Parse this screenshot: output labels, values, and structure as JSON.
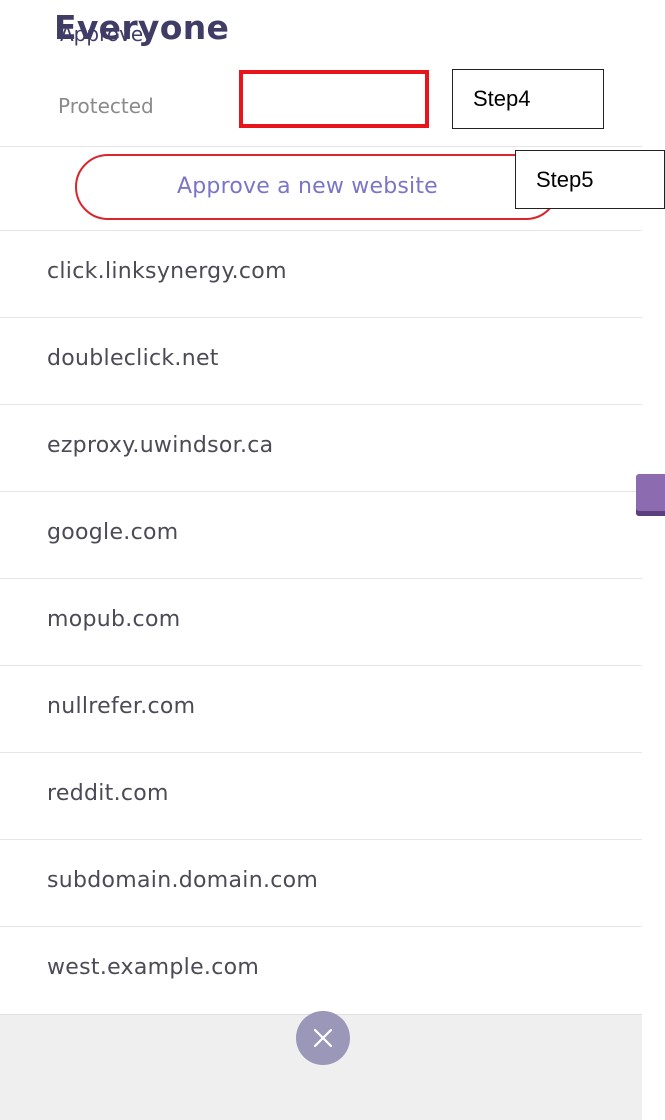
{
  "header": {
    "title": "Everyone"
  },
  "tabs": [
    {
      "label": "Protected",
      "active": false
    },
    {
      "label": "Approve",
      "active": true
    }
  ],
  "annotations": {
    "step4": "Step4",
    "step5": "Step5",
    "highlight_color": "#e8141c"
  },
  "approve_button": {
    "label": "Approve a new website"
  },
  "websites": [
    {
      "domain": "click.linksynergy.com"
    },
    {
      "domain": "doubleclick.net"
    },
    {
      "domain": "ezproxy.uwindsor.ca"
    },
    {
      "domain": "google.com"
    },
    {
      "domain": "mopub.com"
    },
    {
      "domain": "nullrefer.com"
    },
    {
      "domain": "reddit.com"
    },
    {
      "domain": "subdomain.domain.com"
    },
    {
      "domain": "west.example.com"
    }
  ],
  "footer": {
    "close_icon": "close-icon"
  },
  "colors": {
    "brand": "#3f3d66",
    "accent": "#7b75c9",
    "side_tab": "#8d6bb0"
  }
}
